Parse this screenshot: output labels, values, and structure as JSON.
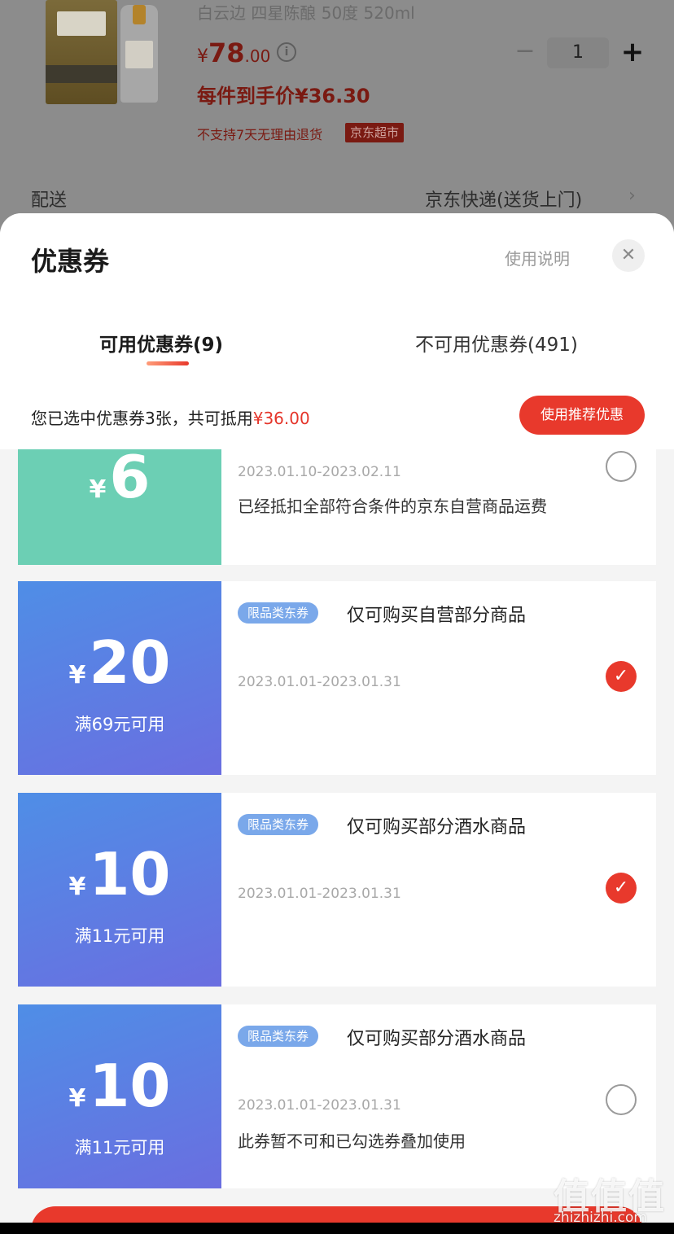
{
  "product": {
    "title": "白云边 四星陈酿 50度 520ml",
    "price_symbol": "¥",
    "price_int": "78",
    "price_dec": ".00",
    "final_price": "每件到手价¥36.30",
    "quantity": "1",
    "minus": "−",
    "plus": "+",
    "info": "i",
    "no_return": "不支持7天无理由退货",
    "badge": "京东超市"
  },
  "shipping": {
    "label": "配送",
    "value": "京东快递(送货上门)",
    "chevron": "›"
  },
  "sheet": {
    "title": "优惠券",
    "help": "使用说明",
    "close": "✕",
    "tabs": [
      {
        "label": "可用优惠券(9)"
      },
      {
        "label": "不可用优惠券(491)"
      }
    ],
    "summary_prefix": "您已选中优惠券3张，共可抵用",
    "summary_amount": "¥36.00",
    "recommend_label": "使用推荐优惠"
  },
  "coupons": [
    {
      "symbol": "¥",
      "amount": "6",
      "date": "2023.01.10-2023.02.11",
      "desc": "已经抵扣全部符合条件的京东自营商品运费",
      "selected": false
    },
    {
      "symbol": "¥",
      "amount": "20",
      "condition": "满69元可用",
      "tag": "限品类东券",
      "title": "仅可购买自营部分商品",
      "date": "2023.01.01-2023.01.31",
      "selected": true
    },
    {
      "symbol": "¥",
      "amount": "10",
      "condition": "满11元可用",
      "tag": "限品类东券",
      "title": "仅可购买部分酒水商品",
      "date": "2023.01.01-2023.01.31",
      "selected": true
    },
    {
      "symbol": "¥",
      "amount": "10",
      "condition": "满11元可用",
      "tag": "限品类东券",
      "title": "仅可购买部分酒水商品",
      "date": "2023.01.01-2023.01.31",
      "desc": "此券暂不可和已勾选券叠加使用",
      "selected": false
    }
  ],
  "check_glyph": "✓",
  "watermark": {
    "mark": "值值值",
    "url": "zhizhizhi.com"
  }
}
